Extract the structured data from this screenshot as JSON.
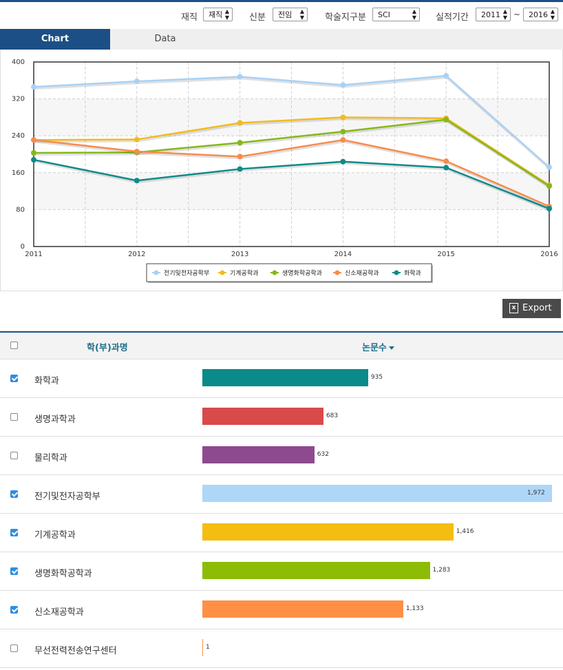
{
  "filters": {
    "status_label": "재직",
    "status_value": "재직",
    "position_label": "신분",
    "position_value": "전임",
    "journal_label": "학술지구분",
    "journal_value": "SCI",
    "period_label": "실적기간",
    "period_from": "2011",
    "period_separator": "~",
    "period_to": "2016"
  },
  "tabs": [
    {
      "label": "Chart",
      "active": true
    },
    {
      "label": "Data",
      "active": false
    }
  ],
  "chart_data": {
    "type": "line",
    "title": "",
    "xlabel": "",
    "ylabel": "",
    "x": [
      "2011",
      "2012",
      "2013",
      "2014",
      "2015",
      "2016"
    ],
    "ylim": [
      0,
      400
    ],
    "yticks": [
      "0",
      "80",
      "160",
      "240",
      "320",
      "400"
    ],
    "grid": true,
    "legend_position": "bottom",
    "series": [
      {
        "name": "전기및전자공학부",
        "color": "#a9d1f5",
        "values": [
          346,
          358,
          368,
          350,
          370,
          172
        ]
      },
      {
        "name": "기계공학과",
        "color": "#f2bb1e",
        "values": [
          231,
          232,
          268,
          280,
          278,
          133
        ]
      },
      {
        "name": "생명화학공학과",
        "color": "#86b818",
        "values": [
          203,
          204,
          225,
          249,
          275,
          131
        ]
      },
      {
        "name": "신소재공학과",
        "color": "#f78c4d",
        "values": [
          231,
          206,
          195,
          231,
          185,
          87
        ]
      },
      {
        "name": "화학과",
        "color": "#0f8a8a",
        "values": [
          188,
          143,
          168,
          184,
          171,
          82
        ]
      }
    ]
  },
  "export_label": "Export",
  "table": {
    "col_name": "학(부)과명",
    "col_count": "논문수",
    "max_value": 1972,
    "rows": [
      {
        "name": "화학과",
        "count": 935,
        "count_label": "935",
        "checked": true,
        "color": "#0a8a8a"
      },
      {
        "name": "생명과학과",
        "count": 683,
        "count_label": "683",
        "checked": false,
        "color": "#d94a4a"
      },
      {
        "name": "물리학과",
        "count": 632,
        "count_label": "632",
        "checked": false,
        "color": "#8e4a8e"
      },
      {
        "name": "전기및전자공학부",
        "count": 1972,
        "count_label": "1,972",
        "checked": true,
        "color": "#aed6f7"
      },
      {
        "name": "기계공학과",
        "count": 1416,
        "count_label": "1,416",
        "checked": true,
        "color": "#f4bd12"
      },
      {
        "name": "생명화학공학과",
        "count": 1283,
        "count_label": "1,283",
        "checked": true,
        "color": "#8cbc06"
      },
      {
        "name": "신소재공학과",
        "count": 1133,
        "count_label": "1,133",
        "checked": true,
        "color": "#ff8f45"
      },
      {
        "name": "무선전력전송연구센터",
        "count": 1,
        "count_label": "1",
        "checked": false,
        "color": "#ff8f45"
      }
    ]
  }
}
